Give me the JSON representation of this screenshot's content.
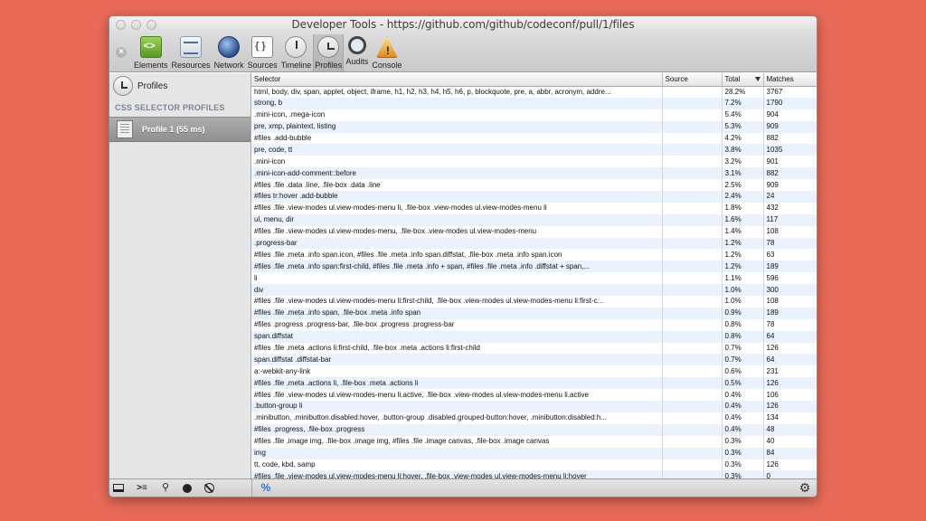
{
  "window": {
    "title": "Developer Tools - https://github.com/github/codeconf/pull/1/files"
  },
  "toolbar": {
    "close_glyph": "×",
    "items": [
      {
        "label": "Elements",
        "icon": "elements-icon"
      },
      {
        "label": "Resources",
        "icon": "resources-icon"
      },
      {
        "label": "Network",
        "icon": "network-icon"
      },
      {
        "label": "Sources",
        "icon": "sources-icon"
      },
      {
        "label": "Timeline",
        "icon": "timeline-icon"
      },
      {
        "label": "Profiles",
        "icon": "profiles-icon",
        "selected": true
      },
      {
        "label": "Audits",
        "icon": "audits-icon"
      },
      {
        "label": "Console",
        "icon": "console-icon"
      }
    ]
  },
  "sidebar": {
    "profiles_label": "Profiles",
    "section_title": "CSS SELECTOR PROFILES",
    "profile_item": "Profile 1 (55 ms)"
  },
  "table": {
    "headers": {
      "selector": "Selector",
      "source": "Source",
      "total": "Total",
      "matches": "Matches"
    },
    "rows": [
      {
        "selector": "html, body, div, span, applet, object, iframe, h1, h2, h3, h4, h5, h6, p, blockquote, pre, a, abbr, acronym, addre...",
        "source": "",
        "total": "28.2%",
        "matches": "3767"
      },
      {
        "selector": "strong, b",
        "source": "",
        "total": "7.2%",
        "matches": "1790"
      },
      {
        "selector": ".mini-icon, .mega-icon",
        "source": "",
        "total": "5.4%",
        "matches": "904"
      },
      {
        "selector": "pre, xmp, plaintext, listing",
        "source": "",
        "total": "5.3%",
        "matches": "909"
      },
      {
        "selector": "#files .add-bubble",
        "source": "",
        "total": "4.2%",
        "matches": "882"
      },
      {
        "selector": "pre, code, tt",
        "source": "",
        "total": "3.8%",
        "matches": "1035"
      },
      {
        "selector": ".mini-icon",
        "source": "",
        "total": "3.2%",
        "matches": "901"
      },
      {
        "selector": ".mini-icon-add-comment::before",
        "source": "",
        "total": "3.1%",
        "matches": "882"
      },
      {
        "selector": "#files .file .data .line, .file-box .data .line",
        "source": "",
        "total": "2.5%",
        "matches": "909"
      },
      {
        "selector": "#files tr:hover .add-bubble",
        "source": "",
        "total": "2.4%",
        "matches": "24"
      },
      {
        "selector": "#files .file .view-modes ul.view-modes-menu li, .file-box .view-modes ul.view-modes-menu li",
        "source": "",
        "total": "1.8%",
        "matches": "432"
      },
      {
        "selector": "ul, menu, dir",
        "source": "",
        "total": "1.6%",
        "matches": "117"
      },
      {
        "selector": "#files .file .view-modes ul.view-modes-menu, .file-box .view-modes ul.view-modes-menu",
        "source": "",
        "total": "1.4%",
        "matches": "108"
      },
      {
        "selector": ".progress-bar",
        "source": "",
        "total": "1.2%",
        "matches": "78"
      },
      {
        "selector": "#files .file .meta .info span.icon, #files .file .meta .info span.diffstat, .file-box .meta .info span.icon",
        "source": "",
        "total": "1.2%",
        "matches": "63"
      },
      {
        "selector": "#files .file .meta .info span:first-child, #files .file .meta .info + span, #files .file .meta .info .diffstat + span,...",
        "source": "",
        "total": "1.2%",
        "matches": "189"
      },
      {
        "selector": "li",
        "source": "",
        "total": "1.1%",
        "matches": "596"
      },
      {
        "selector": "div",
        "source": "",
        "total": "1.0%",
        "matches": "300"
      },
      {
        "selector": "#files .file .view-modes ul.view-modes-menu li:first-child, .file-box .view-modes ul.view-modes-menu li:first-c...",
        "source": "",
        "total": "1.0%",
        "matches": "108"
      },
      {
        "selector": "#files .file .meta .info span, .file-box .meta .info span",
        "source": "",
        "total": "0.9%",
        "matches": "189"
      },
      {
        "selector": "#files .progress .progress-bar, .file-box .progress .progress-bar",
        "source": "",
        "total": "0.8%",
        "matches": "78"
      },
      {
        "selector": "span.diffstat",
        "source": "",
        "total": "0.8%",
        "matches": "64"
      },
      {
        "selector": "#files .file .meta .actions li:first-child, .file-box .meta .actions li:first-child",
        "source": "",
        "total": "0.7%",
        "matches": "126"
      },
      {
        "selector": "span.diffstat .diffstat-bar",
        "source": "",
        "total": "0.7%",
        "matches": "64"
      },
      {
        "selector": "a:-webkit-any-link",
        "source": "",
        "total": "0.6%",
        "matches": "231"
      },
      {
        "selector": "#files .file .meta .actions li, .file-box .meta .actions li",
        "source": "",
        "total": "0.5%",
        "matches": "126"
      },
      {
        "selector": "#files .file .view-modes ul.view-modes-menu li.active, .file-box .view-modes ul.view-modes-menu li.active",
        "source": "",
        "total": "0.4%",
        "matches": "106"
      },
      {
        "selector": ".button-group li",
        "source": "",
        "total": "0.4%",
        "matches": "126"
      },
      {
        "selector": ".minibutton, .minibutton.disabled:hover, .button-group .disabled.grouped-button:hover, .minibutton:disabled:h...",
        "source": "",
        "total": "0.4%",
        "matches": "134"
      },
      {
        "selector": "#files .progress, .file-box .progress",
        "source": "",
        "total": "0.4%",
        "matches": "48"
      },
      {
        "selector": "#files .file .image img, .file-box .image img, #files .file .image canvas, .file-box .image canvas",
        "source": "",
        "total": "0.3%",
        "matches": "40"
      },
      {
        "selector": "img",
        "source": "",
        "total": "0.3%",
        "matches": "84"
      },
      {
        "selector": "tt, code, kbd, samp",
        "source": "",
        "total": "0.3%",
        "matches": "126"
      },
      {
        "selector": "#files .file .view-modes ul.view-modes-menu li:hover, .file-box .view-modes ul.view-modes-menu li:hover",
        "source": "",
        "total": "0.3%",
        "matches": "0"
      }
    ]
  },
  "statusbar": {
    "console_glyph": ">≡",
    "search_glyph": "⚲",
    "percent_glyph": "%",
    "gear_glyph": "⚙"
  }
}
